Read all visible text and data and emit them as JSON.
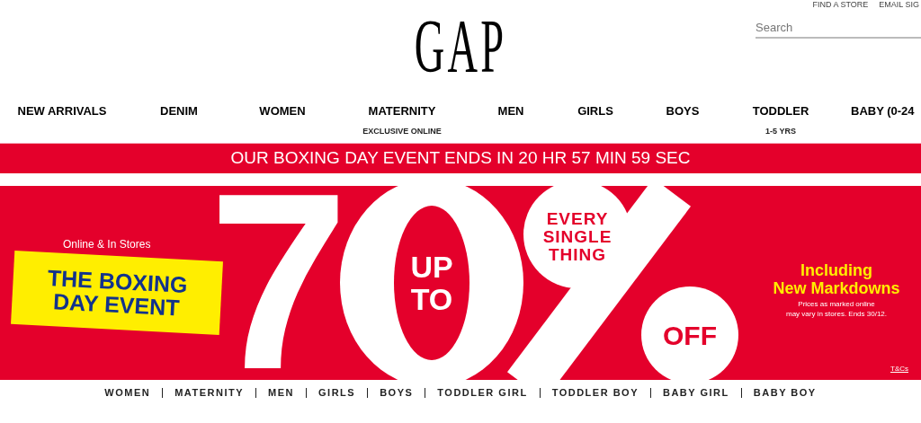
{
  "top_links": [
    "FIND A STORE",
    "EMAIL SIG"
  ],
  "search": {
    "placeholder": "Search"
  },
  "logo": "GAP",
  "nav": [
    {
      "label": "NEW ARRIVALS"
    },
    {
      "label": "DENIM"
    },
    {
      "label": "WOMEN"
    },
    {
      "label": "MATERNITY",
      "sub": "EXCLUSIVE ONLINE"
    },
    {
      "label": "MEN"
    },
    {
      "label": "GIRLS"
    },
    {
      "label": "BOYS"
    },
    {
      "label": "TODDLER",
      "sub": "1-5 YRS"
    },
    {
      "label": "BABY (0-24"
    }
  ],
  "countdown": "OUR BOXING DAY EVENT ENDS IN 20 HR 57 MIN 59 SEC",
  "hero": {
    "kicker": "Online & In Stores",
    "title_lines": [
      "THE BOXING",
      "DAY EVENT"
    ],
    "digit": "7",
    "inside_zero": [
      "UP",
      "TO"
    ],
    "top_circle": [
      "EVERY",
      "SINGLE",
      "THING"
    ],
    "bottom_circle": "OFF",
    "highlight_lines": [
      "Including",
      "New Markdowns"
    ],
    "note_lines": [
      "Prices as marked online",
      "may vary in stores. Ends 30/12."
    ],
    "terms_link": "T&Cs"
  },
  "category_links": [
    "WOMEN",
    "MATERNITY",
    "MEN",
    "GIRLS",
    "BOYS",
    "TODDLER GIRL",
    "TODDLER BOY",
    "BABY GIRL",
    "BABY BOY"
  ]
}
